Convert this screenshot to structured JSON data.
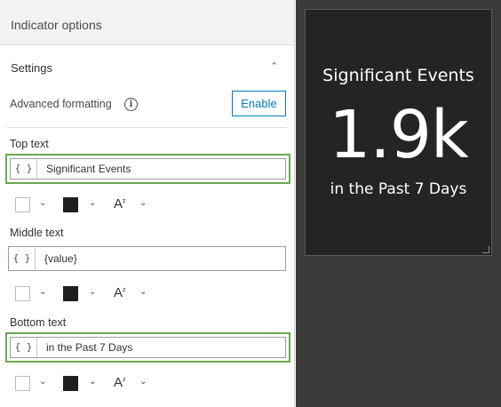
{
  "panel": {
    "title": "Indicator options",
    "section": "Settings",
    "advanced_label": "Advanced formatting",
    "enable_label": "Enable",
    "fields": [
      {
        "label": "Top text",
        "brace": "{ }",
        "value": "Significant Events"
      },
      {
        "label": "Middle text",
        "brace": "{ }",
        "value": "{value}"
      },
      {
        "label": "Bottom text",
        "brace": "{ }",
        "value": "in the Past 7 Days"
      }
    ],
    "colors": {
      "highlight": "#6aa84f",
      "accent": "#007ac2",
      "text_color": "#1f1f1f",
      "background_color": "#ffffff"
    }
  },
  "preview": {
    "top": "Significant Events",
    "middle": "1.9k",
    "bottom": "in the Past 7 Days",
    "colors": {
      "card": "#242424",
      "canvas": "#3a3a3a",
      "text": "#ffffff"
    }
  }
}
